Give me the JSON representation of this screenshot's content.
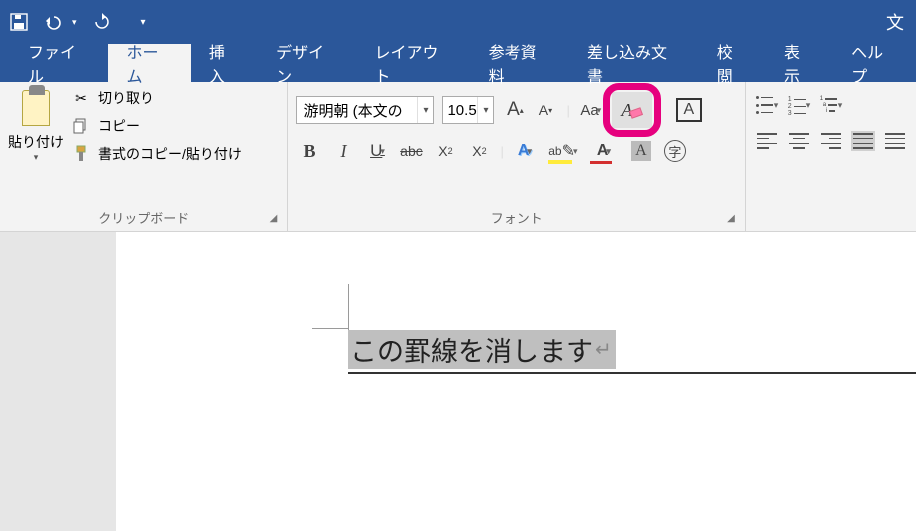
{
  "titlebar": {
    "right_text": "文"
  },
  "tabs": {
    "file": "ファイル",
    "home": "ホーム",
    "insert": "挿入",
    "design": "デザイン",
    "layout": "レイアウト",
    "references": "参考資料",
    "mailings": "差し込み文書",
    "review": "校閲",
    "view": "表示",
    "help": "ヘルプ"
  },
  "clipboard": {
    "paste": "貼り付け",
    "cut": "切り取り",
    "copy": "コピー",
    "format_painter": "書式のコピー/貼り付け",
    "group_label": "クリップボード"
  },
  "font": {
    "name": "游明朝 (本文の",
    "size": "10.5",
    "change_case": "Aa",
    "group_label": "フォント",
    "bold": "B",
    "italic": "I",
    "underline": "U",
    "strike": "abc",
    "sub_x": "X",
    "sub_2": "2",
    "effect_a": "A",
    "color_a": "A",
    "shade_a": "A",
    "circled": "字",
    "char_border_a": "A",
    "grow_a": "A",
    "shrink_a": "A",
    "clear_a": "A"
  },
  "paragraph": {},
  "document": {
    "text": "この罫線を消します",
    "pilcrow": "↵"
  }
}
